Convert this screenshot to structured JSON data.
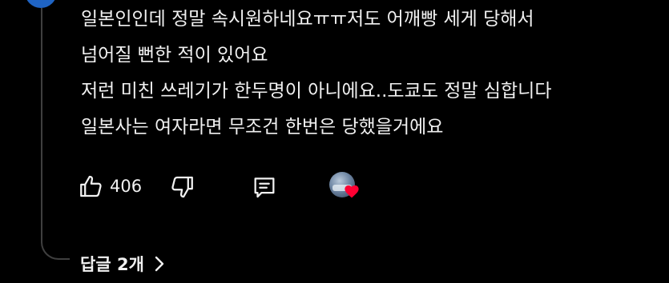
{
  "comment": {
    "lines": [
      "일본인인데 정말 속시원하네요ㅠㅠ저도 어깨빵 세게 당해서",
      "넘어질 뻔한 적이 있어요",
      "저런 미친 쓰레기가 한두명이 아니에요..도쿄도 정말 심합니다",
      "일본사는 여자라면 무조건 한번은 당했을거에요"
    ]
  },
  "actions": {
    "like_count": "406",
    "icons": {
      "like": "thumbs-up-icon",
      "dislike": "thumbs-down-icon",
      "reply": "comment-icon",
      "creator_heart": "heart-icon"
    }
  },
  "replies": {
    "label": "답글 2개",
    "icon": "chevron-right-icon"
  },
  "colors": {
    "background": "#000000",
    "text": "#f1f1f1",
    "thread_line": "#3f3f3f",
    "heart": "#ff0033",
    "avatar_blue": "#1f64c4"
  }
}
